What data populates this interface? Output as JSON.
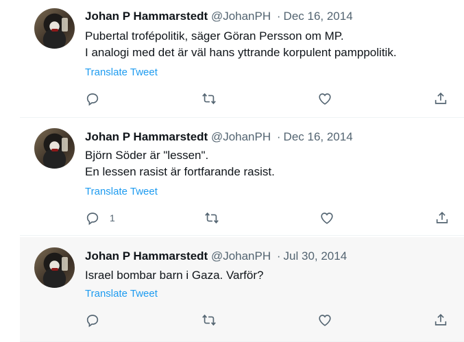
{
  "tweets": [
    {
      "name": "Johan P Hammarstedt",
      "handle": "@JohanPH",
      "separator": "·",
      "date": "Dec 16, 2014",
      "lines": [
        "Pubertal trofépolitik, säger Göran Persson om MP.",
        "I analogi med det är väl hans yttrande korpulent pamppolitik."
      ],
      "translate_label": "Translate Tweet",
      "reply_count": ""
    },
    {
      "name": "Johan P Hammarstedt",
      "handle": "@JohanPH",
      "separator": "·",
      "date": "Dec 16, 2014",
      "lines": [
        "Björn Söder är \"lessen\".",
        "En lessen rasist är fortfarande rasist."
      ],
      "translate_label": "Translate Tweet",
      "reply_count": "1"
    },
    {
      "name": "Johan P Hammarstedt",
      "handle": "@JohanPH",
      "separator": "·",
      "date": "Jul 30, 2014",
      "lines": [
        "Israel bombar barn i Gaza. Varför?"
      ],
      "translate_label": "Translate Tweet",
      "reply_count": ""
    }
  ],
  "icons": {
    "reply": "reply-icon",
    "retweet": "retweet-icon",
    "like": "like-icon",
    "share": "share-icon"
  },
  "colors": {
    "link": "#1d9bf0",
    "secondary_text": "#536471",
    "hover_background": "#f7f7f7"
  }
}
